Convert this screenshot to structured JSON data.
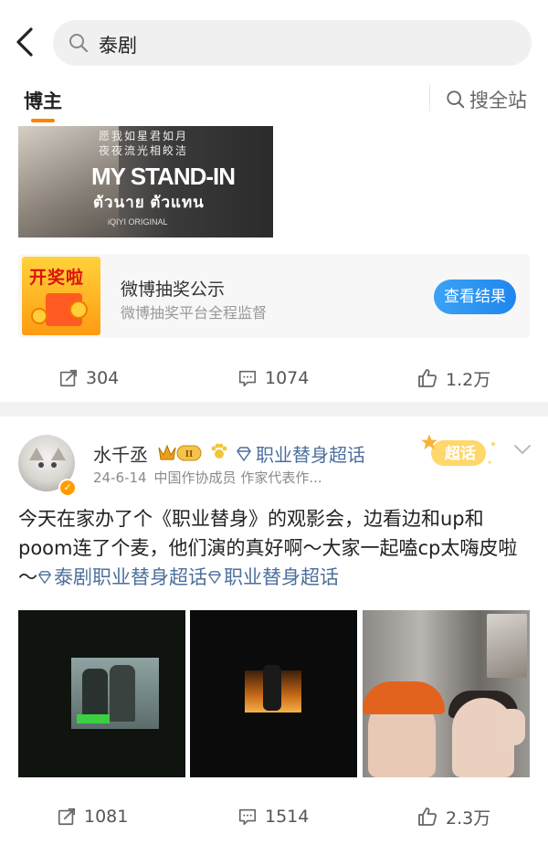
{
  "header": {
    "search_query": "泰剧",
    "tabs": {
      "blogger": "博主",
      "search_all": "搜全站"
    }
  },
  "post1": {
    "poster": {
      "line1": "愿我如星君如月",
      "line2": "夜夜流光相皎洁",
      "title": "MY STAND-IN",
      "thai_title": "ตัวนาย ตัวแทน",
      "brand": "iQIYI ORIGINAL"
    },
    "lottery": {
      "image_text": "开奖啦",
      "title": "微博抽奖公示",
      "subtitle": "微博抽奖平台全程监督",
      "button": "查看结果"
    },
    "actions": {
      "reposts": "304",
      "comments": "1074",
      "likes": "1.2万"
    }
  },
  "post2": {
    "user": {
      "name": "水千丞",
      "level": "II"
    },
    "topic_label": "职业替身超话",
    "meta": {
      "date": "24-6-14",
      "desc": "中国作协成员 作家代表作..."
    },
    "badge": "超话",
    "text": {
      "body": "今天在家办了个《职业替身》的观影会，边看边和up和poom连了个麦，他们演的真好啊～大家一起嗑cp太嗨皮啦～",
      "topic1": "泰剧职业替身超话",
      "topic2": "职业替身超话"
    },
    "actions": {
      "reposts": "1081",
      "comments": "1514",
      "likes": "2.3万"
    }
  },
  "colors": {
    "accent_orange": "#ff8200",
    "link_blue": "#4d6f9c",
    "button_blue": "#1f86ee"
  }
}
